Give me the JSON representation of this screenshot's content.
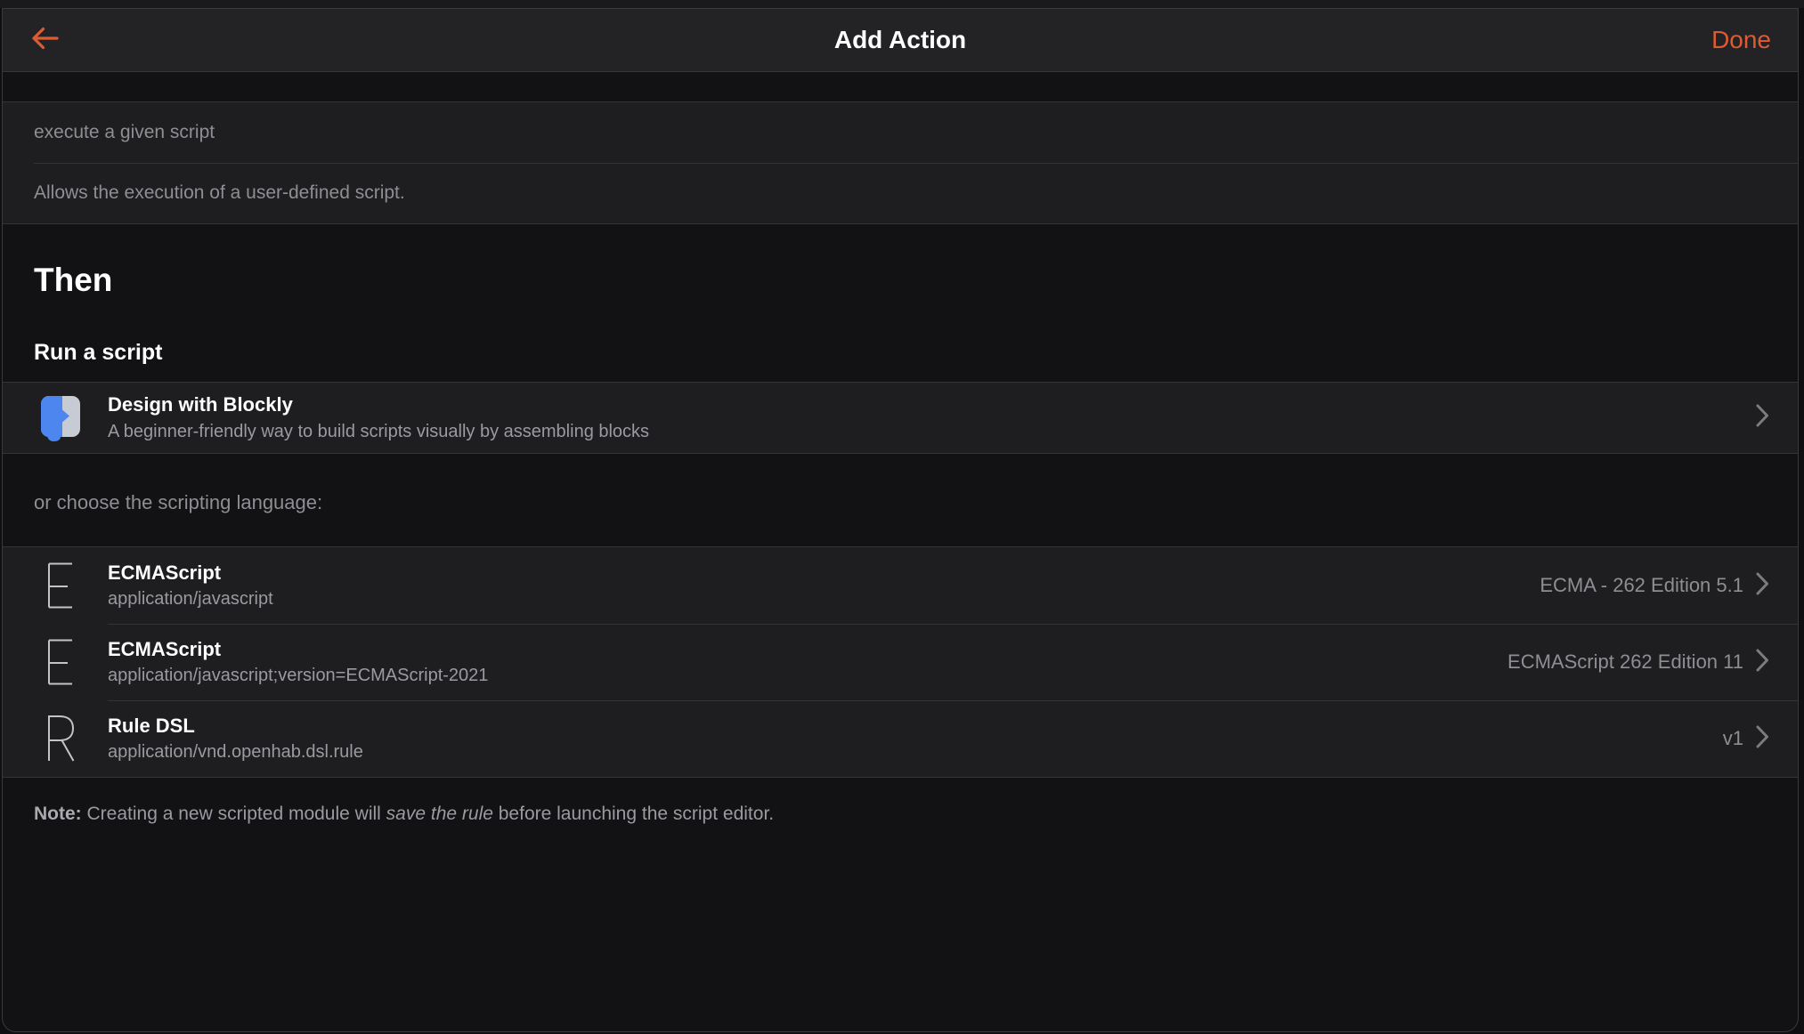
{
  "navbar": {
    "title": "Add Action",
    "done_label": "Done"
  },
  "module": {
    "summary": "execute a given script",
    "description": "Allows the execution of a user-defined script."
  },
  "section": {
    "heading": "Then",
    "subheading": "Run a script"
  },
  "blockly": {
    "title": "Design with Blockly",
    "subtitle": "A beginner-friendly way to build scripts visually by assembling blocks"
  },
  "language_prompt": "or choose the scripting language:",
  "languages": [
    {
      "icon": "letter-e-icon",
      "title": "ECMAScript",
      "mime": "application/javascript",
      "version": "ECMA - 262 Edition 5.1"
    },
    {
      "icon": "letter-e-icon",
      "title": "ECMAScript",
      "mime": "application/javascript;version=ECMAScript-2021",
      "version": "ECMAScript 262 Edition 11"
    },
    {
      "icon": "letter-r-icon",
      "title": "Rule DSL",
      "mime": "application/vnd.openhab.dsl.rule",
      "version": "v1"
    }
  ],
  "note": {
    "label": "Note:",
    "text_before_italic": " Creating a new scripted module will ",
    "italic_text": "save the rule",
    "text_after_italic": " before launching the script editor."
  },
  "icons": {
    "back": "back-arrow-icon",
    "blockly": "blockly-icon",
    "chevron": "chevron-right-icon"
  },
  "colors": {
    "accent": "#dd5b33",
    "page_bg": "#121214",
    "navbar_bg": "#232326",
    "list_bg": "#1e1e20",
    "divider": "#343438",
    "title_text": "#ffffff",
    "muted_text": "#8e8e93",
    "blockly_blue": "#4d86ee"
  }
}
